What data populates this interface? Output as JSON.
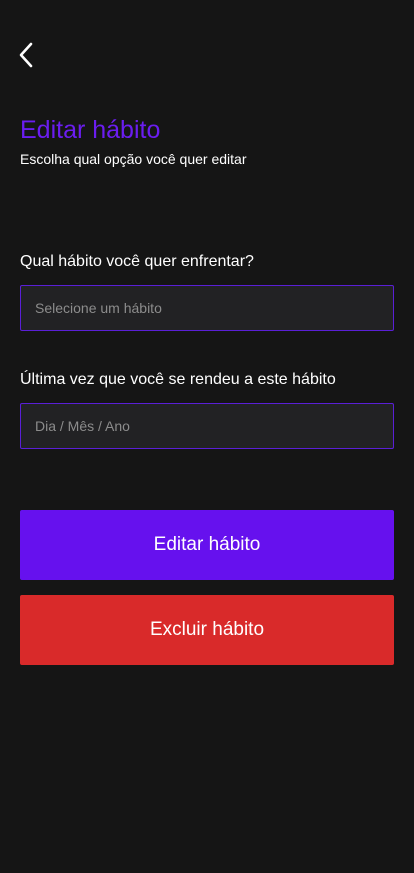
{
  "header": {
    "back_icon": "chevron-left-icon"
  },
  "page": {
    "title": "Editar hábito",
    "subtitle": "Escolha qual opção você quer editar"
  },
  "form": {
    "habit_label": "Qual hábito você quer enfrentar?",
    "habit_placeholder": "Selecione um hábito",
    "date_label": "Última vez que você se rendeu a este hábito",
    "date_placeholder": "Dia / Mês / Ano"
  },
  "actions": {
    "edit_label": "Editar hábito",
    "delete_label": "Excluir hábito"
  },
  "colors": {
    "background": "#151515",
    "accent": "#6611ee",
    "danger": "#d92a2a",
    "input_border": "#5a1fd6"
  }
}
